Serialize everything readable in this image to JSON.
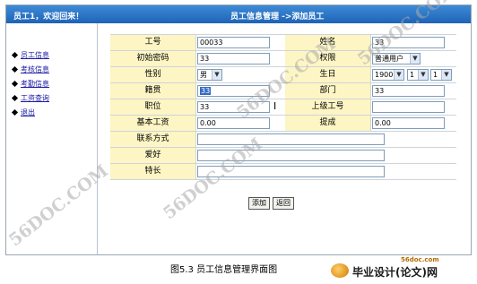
{
  "header": {
    "welcome": "员工1，欢迎回来！",
    "title": "员工信息管理 ->添加员工"
  },
  "sidebar": {
    "items": [
      {
        "label": "员工信息"
      },
      {
        "label": "考核信息"
      },
      {
        "label": "考勤信息"
      },
      {
        "label": "工资查询"
      },
      {
        "label": "退出"
      }
    ]
  },
  "form": {
    "emp_no": {
      "label": "工号",
      "value": "00033"
    },
    "name": {
      "label": "姓名",
      "value": "33"
    },
    "init_pwd": {
      "label": "初始密码",
      "value": "33"
    },
    "permission": {
      "label": "权限",
      "value": "普通用户"
    },
    "gender": {
      "label": "性别",
      "value": "男"
    },
    "birthday": {
      "label": "生日",
      "year": "1900",
      "month": "1",
      "day": "1"
    },
    "native_place": {
      "label": "籍贯",
      "value": "33"
    },
    "department": {
      "label": "部门",
      "value": "33"
    },
    "position": {
      "label": "职位",
      "value": "33"
    },
    "manager_no": {
      "label": "上级工号",
      "value": ""
    },
    "base_salary": {
      "label": "基本工资",
      "value": "0.00"
    },
    "commission": {
      "label": "提成",
      "value": "0.00"
    },
    "contact": {
      "label": "联系方式",
      "value": ""
    },
    "hobby": {
      "label": "爱好",
      "value": ""
    },
    "specialty": {
      "label": "特长",
      "value": ""
    }
  },
  "buttons": {
    "add": "添加",
    "back": "返回"
  },
  "caption": "图5.3   员工信息管理界面图",
  "watermark": "56DOC.COM",
  "brand": {
    "url": "56doc.com",
    "name": "毕业设计(论文)网"
  }
}
